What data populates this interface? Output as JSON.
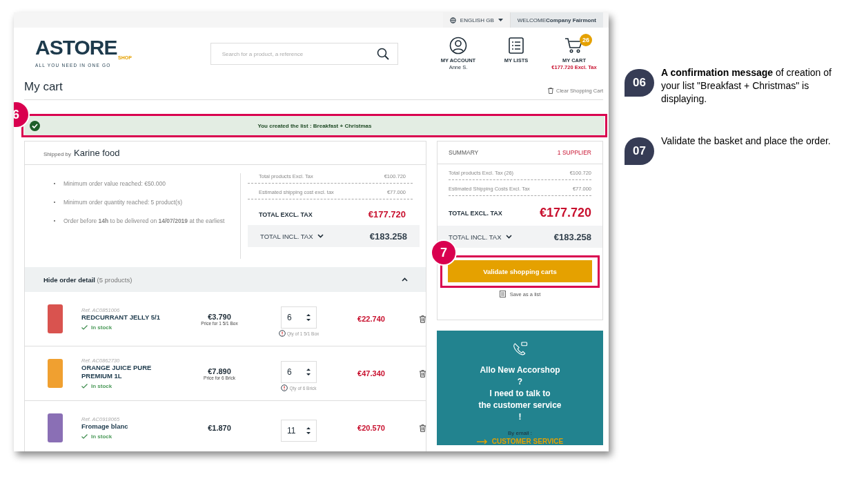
{
  "top_bar": {
    "language": "ENGLISH GB",
    "welcome_label": "WELCOME",
    "welcome_name": "Company Fairmont"
  },
  "header": {
    "logo_main": "ASTORE",
    "logo_sub": "SHOP",
    "logo_tagline": "ALL YOU NEED IN ONE GO",
    "search": {
      "placeholder": "Search for a product, a reference"
    },
    "nav": [
      {
        "kind": "account",
        "label": "MY ACCOUNT",
        "sub": "Anne S."
      },
      {
        "kind": "lists",
        "label": "MY LISTS"
      },
      {
        "kind": "cart",
        "label": "MY CART",
        "sub": "€177.720 Excl. Tax",
        "badge": "26"
      }
    ]
  },
  "page_title": "My cart",
  "clear_cart": "Clear Shopping Cart",
  "message": {
    "text": "You created the list : Breakfast + Christmas"
  },
  "supplier": {
    "shipped_by": "Shipped by",
    "name": "Karine food",
    "conditions": [
      "Minimum order value reached: €50.000",
      "Minimum order quantity reached: 5 product(s)",
      "Order before **14h** to be delivered on **14/07/2019** at the earliest"
    ],
    "lines": [
      {
        "label": "Total products Excl. Tax",
        "value": "€100.720"
      },
      {
        "label": "Estimated shipping cost excl. tax",
        "value": "€77.000"
      }
    ],
    "total_excl": {
      "label": "TOTAL EXCL. TAX",
      "value": "€177.720"
    },
    "total_incl": {
      "label": "TOTAL INCL. TAX",
      "value": "€183.258",
      "expanded": false
    },
    "detail_toggle": {
      "label": "Hide order detail",
      "count": "(5 products)",
      "expanded": true
    },
    "products": [
      {
        "ref": "Ref. AC0851006",
        "name": "REDCURRANT JELLY 5/1",
        "stock": "In stock",
        "price": "€3.790",
        "price_note": "Price for 1 5/1 Box",
        "qty": "6",
        "qty_note": "Qty of 1 5/1 Box",
        "total": "€22.740",
        "color": "#d9534f"
      },
      {
        "ref": "Ref. AC0862730",
        "name": "ORANGE JUICE PURE PREMIUM 1L",
        "stock": "In stock",
        "price": "€7.890",
        "price_note": "Price for 6 Brick",
        "qty": "6",
        "qty_note": "Qty of 6 Brick",
        "total": "€47.340",
        "color": "#f0a030"
      },
      {
        "ref": "Ref. AC0918065",
        "name": "Fromage blanc",
        "stock": "In stock",
        "price": "€1.870",
        "qty": "11",
        "total": "€20.570",
        "color": "#8a6fb5"
      }
    ]
  },
  "summary": {
    "title": "SUMMARY",
    "suppliers": "1 SUPPLIER",
    "lines": [
      {
        "label": "Total products Excl. Tax (26)",
        "value": "€100.720"
      },
      {
        "label": "Estimated Shipping Costs Excl. Tax",
        "value": "€77.000"
      }
    ],
    "total_excl": {
      "label": "TOTAL EXCL. TAX",
      "value": "€177.720"
    },
    "total_incl": {
      "label": "TOTAL INCL. TAX",
      "value": "€183.258",
      "expanded": false
    },
    "validate_button": "Validate shopping carts",
    "save_list": "Save as a list"
  },
  "service": {
    "lines": [
      "Allo New Accorshop",
      "?",
      "I need to talk to",
      "the customer service",
      "!"
    ],
    "by_email": "By email :",
    "link": "CUSTOMER SERVICE"
  },
  "callouts": [
    "6",
    "7"
  ],
  "steps": [
    {
      "number": "06",
      "text": "**A confirmation message** of creation of your list \"Breakfast + Christmas\" is displaying."
    },
    {
      "number": "07",
      "text": "Validate the basket and place the order."
    }
  ]
}
